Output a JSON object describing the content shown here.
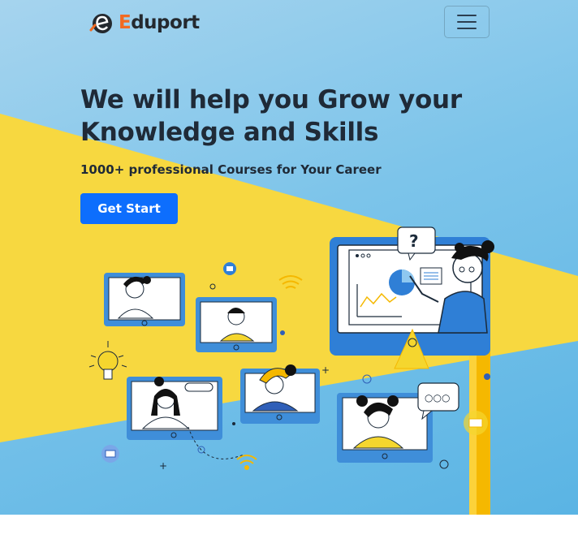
{
  "brand": {
    "name_first_letter": "E",
    "name_rest": "duport",
    "accent_color": "#f26a21"
  },
  "nav": {
    "toggle_icon": "hamburger-menu-icon"
  },
  "hero": {
    "headline_line1": "We will help you Grow your",
    "headline_line2": "Knowledge and Skills",
    "subheadline": "1000+ professional Courses for Your Career",
    "cta_label": "Get Start",
    "cta_color": "#0d6efd",
    "background_color": "#7cc4ea",
    "highlight_color": "#f7d840"
  },
  "illustration": {
    "question_mark": "?",
    "chat_ellipsis": "○○○",
    "icons": [
      "lightbulb-icon",
      "mail-icon",
      "wifi-icon",
      "video-call-screen",
      "presentation-screen"
    ]
  }
}
